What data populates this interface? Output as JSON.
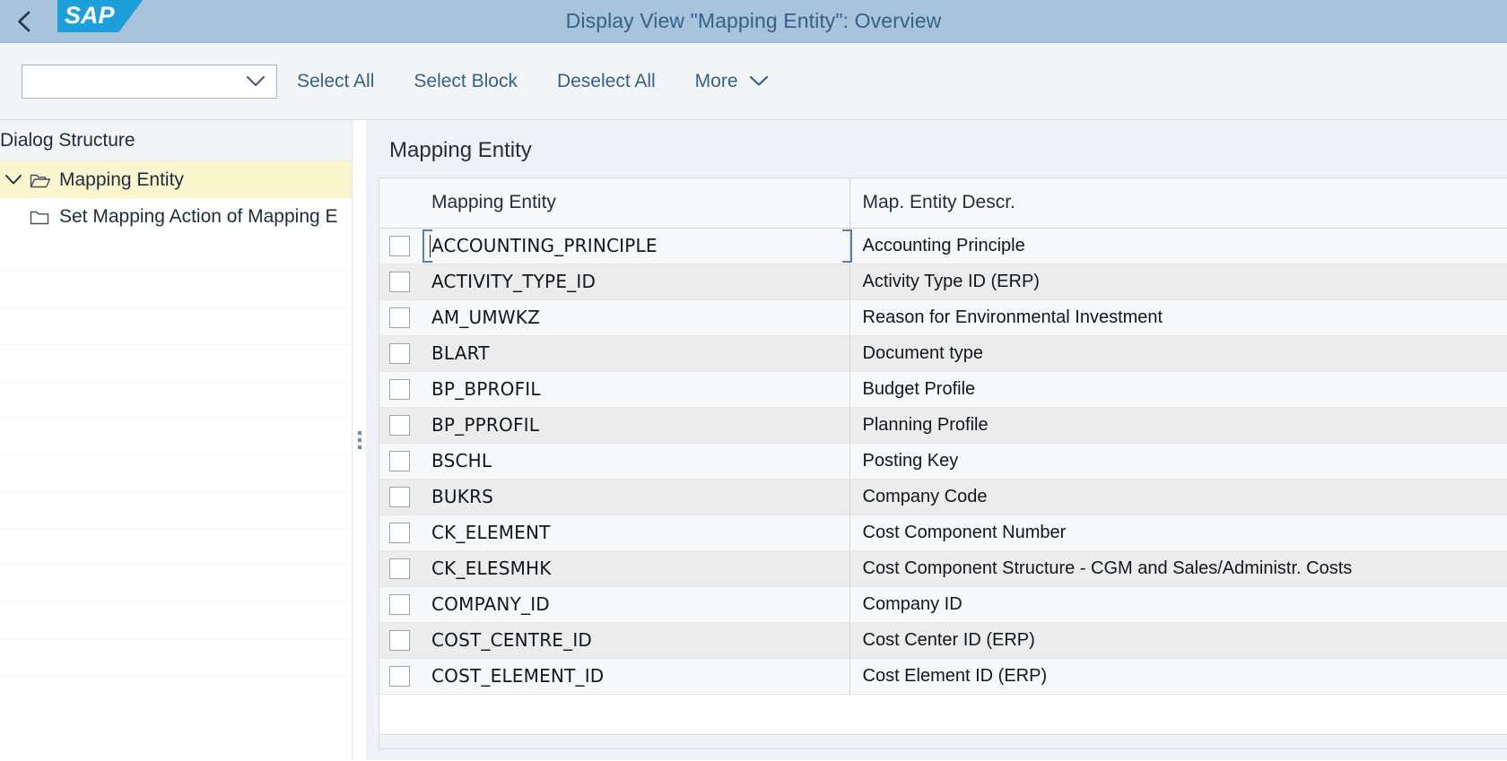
{
  "header": {
    "back_icon": "chevron-left-icon",
    "logo_text": "SAP",
    "title": "Display View \"Mapping Entity\": Overview"
  },
  "toolbar": {
    "select_value": "",
    "select_placeholder": "",
    "dropdown_icon": "chevron-down-icon",
    "buttons": [
      {
        "label": "Select All"
      },
      {
        "label": "Select Block"
      },
      {
        "label": "Deselect All"
      },
      {
        "label": "More",
        "icon": "chevron-down-icon"
      }
    ]
  },
  "sidebar": {
    "title": "Dialog Structure",
    "items": [
      {
        "label": "Mapping Entity",
        "icon": "open-folder-icon",
        "expander": "chevron-down-icon",
        "selected": true,
        "level": 0
      },
      {
        "label": "Set Mapping Action of Mapping E",
        "icon": "folder-icon",
        "selected": false,
        "level": 1
      }
    ]
  },
  "main": {
    "section_title": "Mapping Entity",
    "table": {
      "columns": [
        "",
        "Mapping Entity",
        "Map. Entity Descr."
      ],
      "rows": [
        {
          "checked": false,
          "entity": "ACCOUNTING_PRINCIPLE",
          "descr": "Accounting Principle"
        },
        {
          "checked": false,
          "entity": "ACTIVITY_TYPE_ID",
          "descr": "Activity Type ID (ERP)"
        },
        {
          "checked": false,
          "entity": "AM_UMWKZ",
          "descr": "Reason for Environmental Investment"
        },
        {
          "checked": false,
          "entity": "BLART",
          "descr": "Document type"
        },
        {
          "checked": false,
          "entity": "BP_BPROFIL",
          "descr": "Budget Profile"
        },
        {
          "checked": false,
          "entity": "BP_PPROFIL",
          "descr": "Planning Profile"
        },
        {
          "checked": false,
          "entity": "BSCHL",
          "descr": "Posting Key"
        },
        {
          "checked": false,
          "entity": "BUKRS",
          "descr": "Company Code"
        },
        {
          "checked": false,
          "entity": "CK_ELEMENT",
          "descr": "Cost Component Number"
        },
        {
          "checked": false,
          "entity": "CK_ELESMHK",
          "descr": "Cost Component Structure - CGM and Sales/Administr. Costs"
        },
        {
          "checked": false,
          "entity": "COMPANY_ID",
          "descr": "Company ID"
        },
        {
          "checked": false,
          "entity": "COST_CENTRE_ID",
          "descr": "Cost Center ID (ERP)"
        },
        {
          "checked": false,
          "entity": "COST_ELEMENT_ID",
          "descr": "Cost Element ID (ERP)"
        }
      ]
    }
  },
  "colors": {
    "header_bg": "#a8c4dc",
    "header_text": "#346187",
    "logo_blue": "#1ca0dc",
    "toolbar_bg": "#f2f5f8",
    "link_blue": "#346187",
    "tree_selected_bg": "#fbf6cd",
    "content_bg": "#eef2f6",
    "row_odd_bg": "#f7f8f9",
    "row_even_bg": "#ececec",
    "focus_border": "#5b7f9e"
  }
}
